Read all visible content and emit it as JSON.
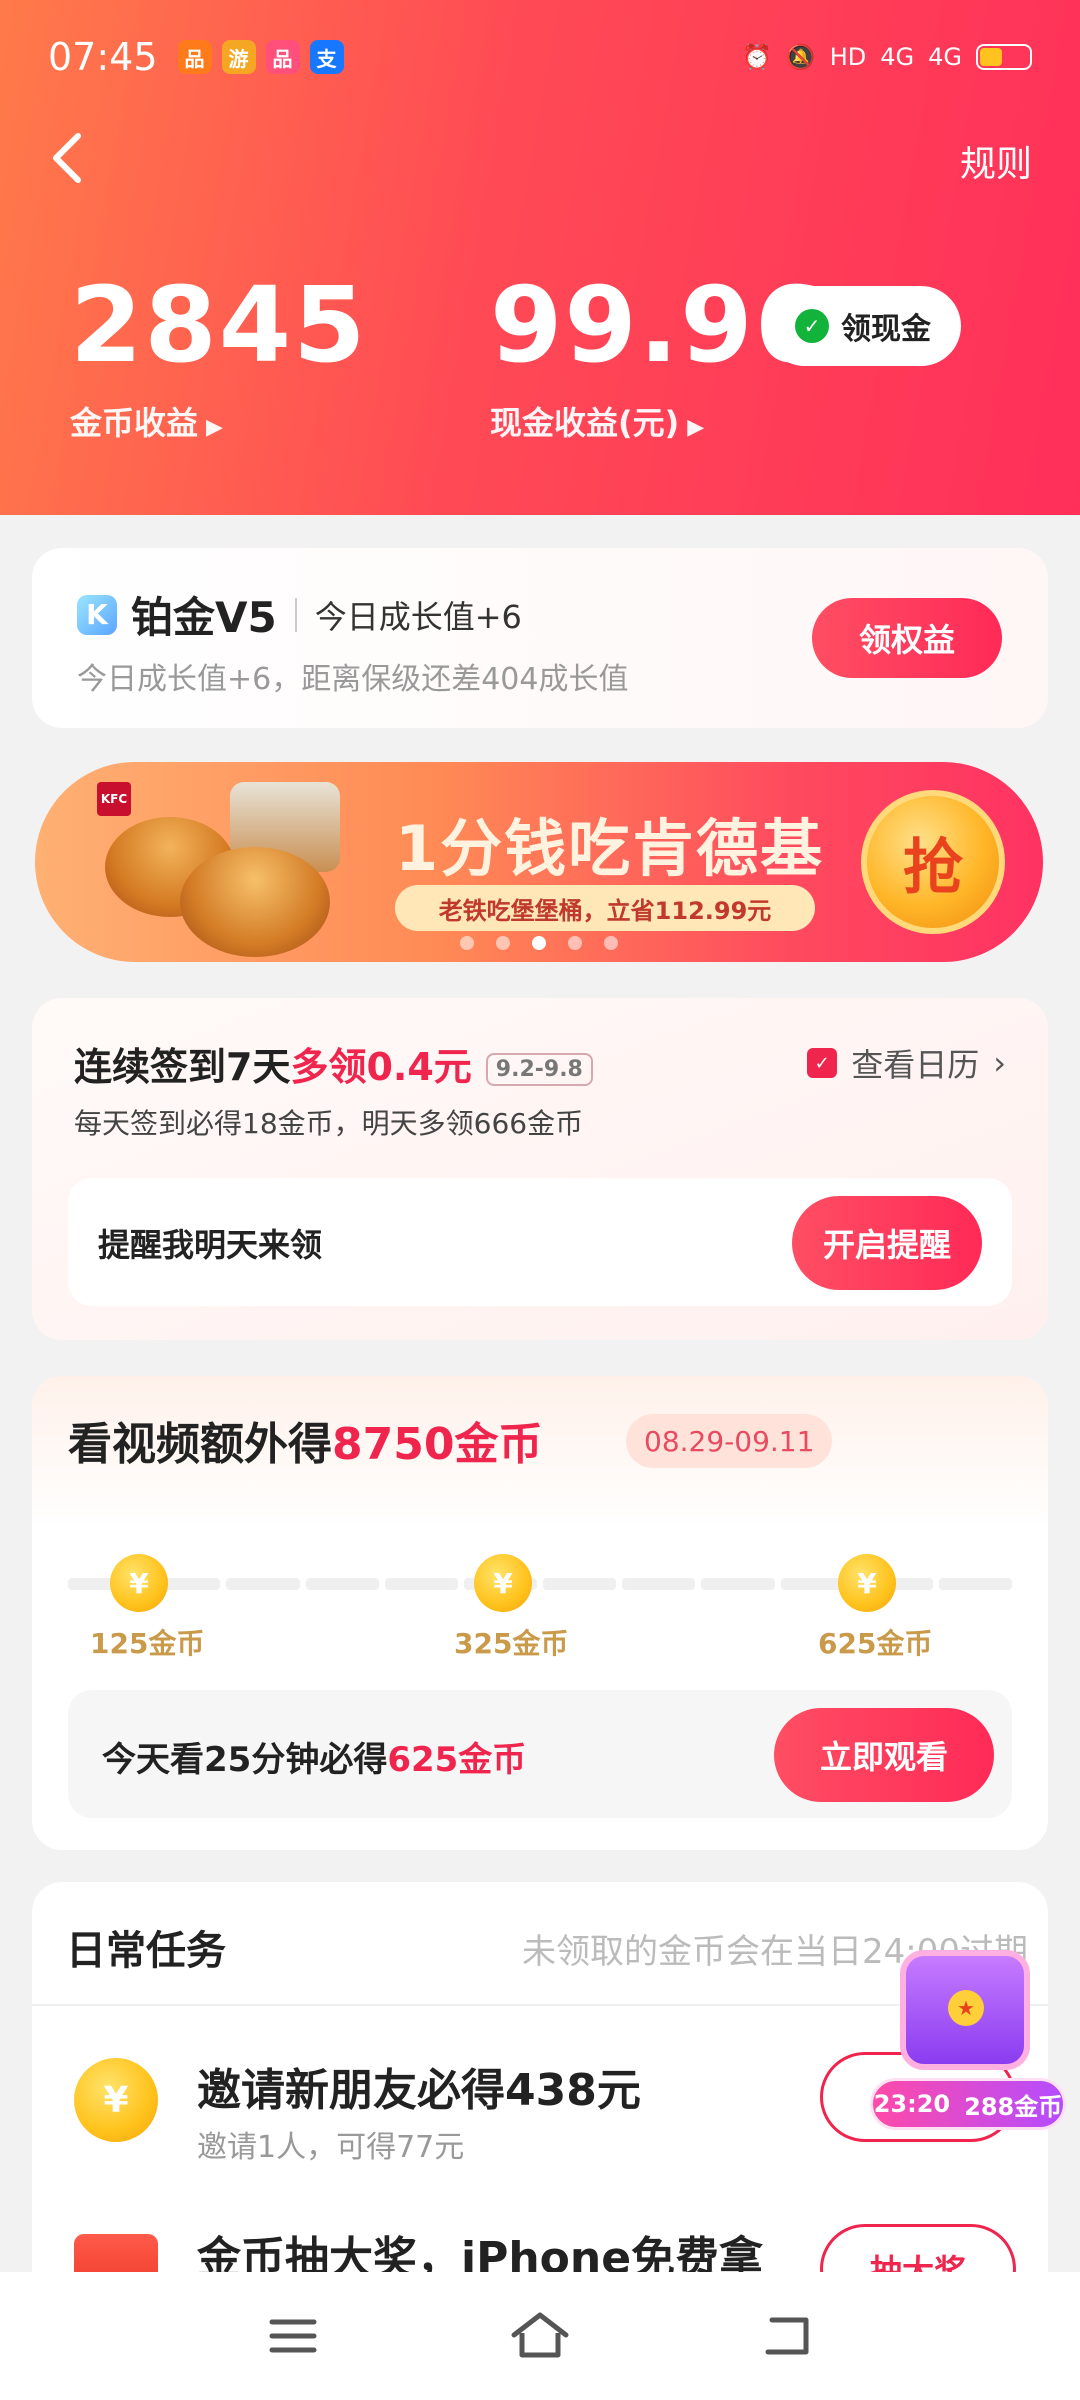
{
  "status_bar": {
    "time": "07:45",
    "apps": [
      {
        "name": "taobao-app-icon",
        "glyph": "品",
        "color": "#ff7a1a"
      },
      {
        "name": "game-app-icon",
        "glyph": "游",
        "color": "#f5a623"
      },
      {
        "name": "shop-app-icon",
        "glyph": "品",
        "color": "#ff4f7a"
      },
      {
        "name": "alipay-app-icon",
        "glyph": "支",
        "color": "#1677ff"
      }
    ],
    "indicators": [
      "HD",
      "4G",
      "4G"
    ]
  },
  "header": {
    "rules_label": "规则",
    "coin": {
      "value": "2845",
      "label": "金币收益"
    },
    "cash": {
      "value": "99.96",
      "label": "现金收益(元)"
    },
    "cash_button": "领现金"
  },
  "vip": {
    "badge": "K",
    "level": "铂金V5",
    "today": "今日成长值+6",
    "desc": "今日成长值+6，距离保级还差404成长值",
    "button": "领权益"
  },
  "banner": {
    "title": "1分钱吃肯德基",
    "subtitle": "老铁吃堡堡桶，立省112.99元",
    "grab": "抢",
    "brand": "KFC",
    "dots": 5,
    "active_dot": 2
  },
  "checkin": {
    "title_pre": "连续签到7天",
    "title_hl": "多领0.4元",
    "dates": "9.2-9.8",
    "calendar": "查看日历",
    "desc": "每天签到必得18金币，明天多领666金币",
    "remind_label": "提醒我明天来领",
    "remind_button": "开启提醒"
  },
  "video": {
    "title_pre": "看视频额外得",
    "title_hl": "8750金币",
    "range": "08.29-09.11",
    "milestones": [
      "125金币",
      "325金币",
      "625金币"
    ],
    "coin_glyph": "¥",
    "progress_fraction": 0,
    "watch_pre": "今天看25分钟必得",
    "watch_hl": "625金币",
    "watch_button": "立即观看"
  },
  "daily": {
    "heading": "日常任务",
    "note": "未领取的金币会在当日24:00过期",
    "tasks": [
      {
        "title": "邀请新朋友必得438元",
        "sub": "邀请1人，可得77元",
        "icon": "¥",
        "button": ""
      },
      {
        "title": "金币抽大奖，iPhone免费拿",
        "sub": "",
        "icon": "",
        "button": "抽大奖"
      }
    ]
  },
  "chest": {
    "timer": "23:20",
    "reward": "288金币"
  },
  "colors": {
    "accent": "#f0254e",
    "header_start": "#ff7a4a",
    "header_end": "#ff2f5a",
    "coin": "#ffc21b"
  }
}
